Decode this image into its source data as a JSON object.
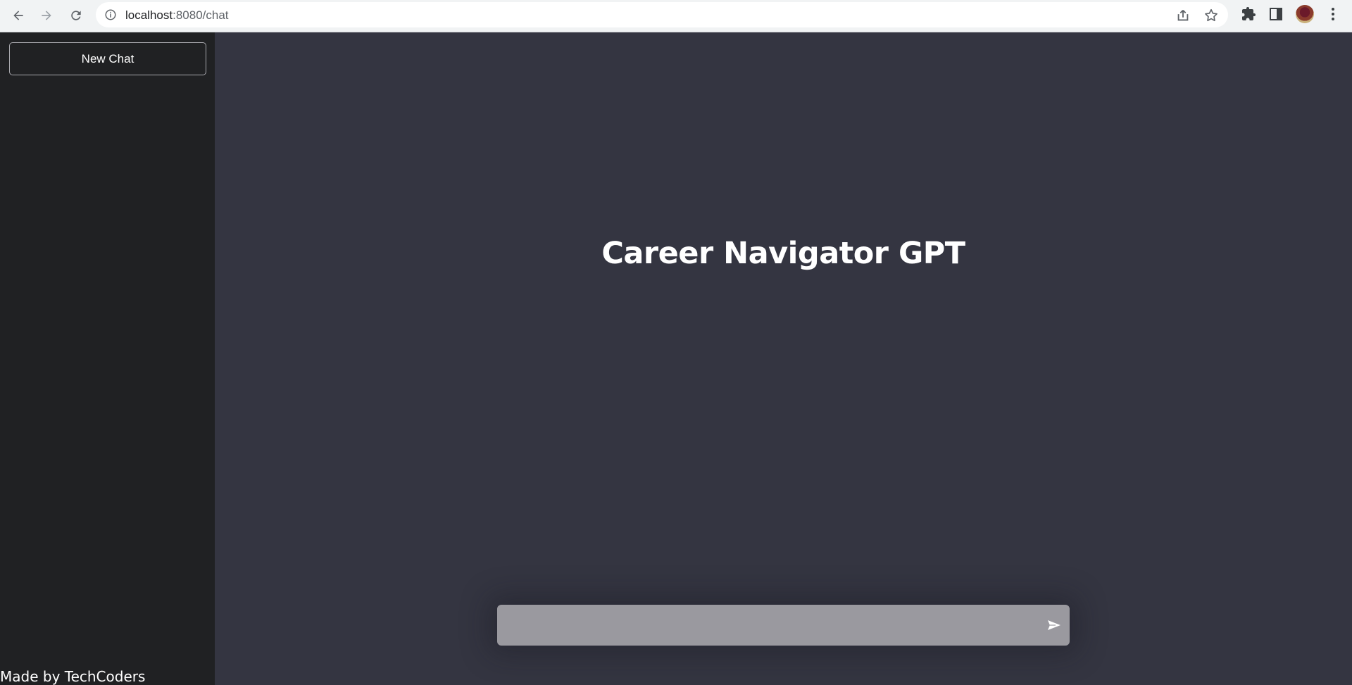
{
  "browser": {
    "url_host": "localhost",
    "url_port_path": ":8080/chat",
    "icons": {
      "back": "arrow-left-icon",
      "forward": "arrow-right-icon",
      "reload": "reload-icon",
      "info": "info-icon",
      "share": "share-icon",
      "bookmark": "star-icon",
      "extensions": "puzzle-icon",
      "sidepanel": "sidepanel-icon",
      "menu": "kebab-menu-icon"
    }
  },
  "sidebar": {
    "new_chat_label": "New Chat",
    "footer": "Made by TechCoders"
  },
  "main": {
    "title": "Career Navigator GPT",
    "input_value": "",
    "send_icon": "send-icon"
  },
  "colors": {
    "sidebar_bg": "#202123",
    "main_bg": "#343541",
    "input_bg": "#9a999f",
    "text": "#ffffff"
  }
}
